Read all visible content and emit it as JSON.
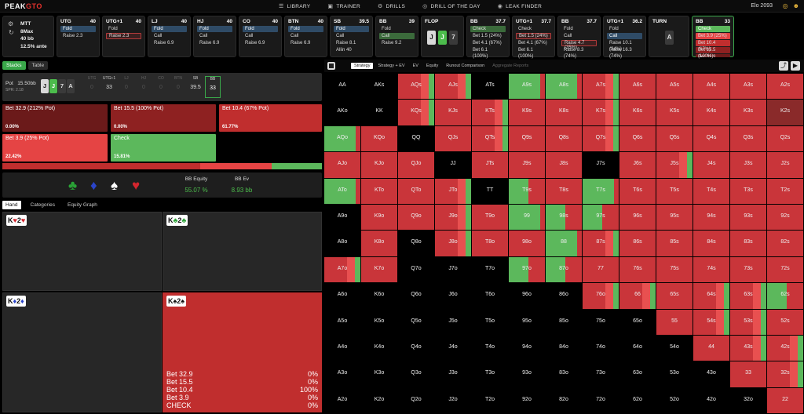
{
  "app": {
    "logo_main": "PEAK",
    "logo_accent": "GTO"
  },
  "nav": [
    {
      "icon": "☰",
      "label": "LIBRARY"
    },
    {
      "icon": "▣",
      "label": "TRAINER"
    },
    {
      "icon": "⚙",
      "label": "DRILLS"
    },
    {
      "icon": "◎",
      "label": "DRILL OF THE DAY"
    },
    {
      "icon": "◉",
      "label": "LEAK FINDER"
    }
  ],
  "elo": "Elo 2093",
  "settings": {
    "game": "MTT",
    "table": "8Max",
    "stack": "40 bb",
    "ante": "12.5% ante"
  },
  "positions": [
    {
      "name": "UTG",
      "stack": "40",
      "actions": [
        "Fold",
        "Raise 2.3"
      ],
      "sel": 0,
      "selstyle": "fold"
    },
    {
      "name": "UTG+1",
      "stack": "40",
      "actions": [
        "Fold",
        "Raise 2.3"
      ],
      "sel": 1,
      "selstyle": "red"
    },
    {
      "name": "LJ",
      "stack": "40",
      "actions": [
        "Fold",
        "Call",
        "Raise 6.9"
      ],
      "sel": 0,
      "selstyle": "fold"
    },
    {
      "name": "HJ",
      "stack": "40",
      "actions": [
        "Fold",
        "Call",
        "Raise 6.9"
      ],
      "sel": 0,
      "selstyle": "fold"
    },
    {
      "name": "CO",
      "stack": "40",
      "actions": [
        "Fold",
        "Call",
        "Raise 6.9"
      ],
      "sel": 0,
      "selstyle": "fold"
    },
    {
      "name": "BTN",
      "stack": "40",
      "actions": [
        "Fold",
        "Call",
        "Raise 6.9"
      ],
      "sel": 0,
      "selstyle": "fold"
    },
    {
      "name": "SB",
      "stack": "39.5",
      "actions": [
        "Fold",
        "Call",
        "Raise 8.1",
        "Allin 40"
      ],
      "sel": 0,
      "selstyle": "fold"
    },
    {
      "name": "BB",
      "stack": "39",
      "actions": [
        "Fold",
        "Call",
        "Raise 9.2"
      ],
      "sel": 1,
      "selstyle": "green"
    }
  ],
  "flop": {
    "name": "FLOP",
    "cards": [
      "J",
      "J",
      "7"
    ]
  },
  "postflop": [
    {
      "name": "BB",
      "stack": "37.7",
      "actions": [
        "Check",
        "Bet 1.5 (24%)",
        "Bet 4.1 (67%)",
        "Bet 6.1 (100%)"
      ],
      "sel": 0,
      "selstyle": "green"
    },
    {
      "name": "UTG+1",
      "stack": "37.7",
      "actions": [
        "Check",
        "Bet 1.5 (24%)",
        "Bet 4.1 (67%)",
        "Bet 6.1 (100%)"
      ],
      "sel": 1,
      "selstyle": "red"
    },
    {
      "name": "BB",
      "stack": "37.7",
      "actions": [
        "Fold",
        "Call",
        "Raise 4.7 (35%)",
        "Raise 8.3 (74%)"
      ],
      "sel": 2,
      "selstyle": "red"
    },
    {
      "name": "UTG+1",
      "stack": "36.2",
      "actions": [
        "Fold",
        "Call",
        "Raise 10.1 (34%)",
        "Raise 16.3 (74%)"
      ],
      "sel": 1,
      "selstyle": "fold"
    }
  ],
  "turn": {
    "name": "TURN",
    "card": "A"
  },
  "current": {
    "name": "BB",
    "stack": "33",
    "actions": [
      "Check",
      "Bet 3.9 (25%)",
      "Bet 10.4 (67%)",
      "Bet 15.5 (100%)",
      "Bet 32.9 (212%)"
    ]
  },
  "left_tabs": [
    "Stacks",
    "Table"
  ],
  "pot": {
    "label": "Pot",
    "value": "15.50bb",
    "spr": "SPR: 2.18",
    "cards": [
      "J",
      "J",
      "7",
      "A"
    ]
  },
  "pot_positions": [
    {
      "name": "UTG",
      "val": "0"
    },
    {
      "name": "UTG+1",
      "val": "33"
    },
    {
      "name": "LJ",
      "val": "0"
    },
    {
      "name": "HJ",
      "val": "0"
    },
    {
      "name": "CO",
      "val": "0"
    },
    {
      "name": "BTN",
      "val": "0"
    },
    {
      "name": "SB",
      "val": "39.5"
    },
    {
      "name": "BB",
      "val": "33"
    }
  ],
  "strategy": [
    {
      "label": "Bet 32.9 (212% Pot)",
      "pct": "0.00%",
      "color": "#6b1a1a"
    },
    {
      "label": "Bet 15.5 (100% Pot)",
      "pct": "0.00%",
      "color": "#8e2121"
    },
    {
      "label": "Bet 10.4 (67% Pot)",
      "pct": "61.77%",
      "color": "#c02e2e"
    },
    {
      "label": "Bet 3.9 (25% Pot)",
      "pct": "22.42%",
      "color": "#e54444"
    },
    {
      "label": "Check",
      "pct": "15.81%",
      "color": "#5cb85c"
    }
  ],
  "freqbar": [
    {
      "frac": 0.618,
      "color": "#c02e2e"
    },
    {
      "frac": 0.224,
      "color": "#e54444"
    },
    {
      "frac": 0.158,
      "color": "#5cb85c"
    }
  ],
  "equity": {
    "eq_label": "BB Equity",
    "eq_value": "55.07 %",
    "ev_label": "BB Ev",
    "ev_value": "8.93 bb"
  },
  "hand_tabs": [
    "Hand",
    "Categories",
    "Equity Graph"
  ],
  "hands": [
    {
      "rank1": "K",
      "suit1": "♥",
      "rank2": "2",
      "suit2": "♥",
      "color": "red"
    },
    {
      "rank1": "K",
      "suit1": "♣",
      "rank2": "2",
      "suit2": "♣",
      "color": "grn"
    },
    {
      "rank1": "K",
      "suit1": "♦",
      "rank2": "2",
      "suit2": "♦",
      "color": "blu"
    },
    {
      "rank1": "K",
      "suit1": "♠",
      "rank2": "2",
      "suit2": "♠",
      "color": "blk"
    }
  ],
  "hand_stats": [
    {
      "label": "Bet 32.9",
      "value": "0%"
    },
    {
      "label": "Bet 15.5",
      "value": "0%"
    },
    {
      "label": "Bet 10.4",
      "value": "100%"
    },
    {
      "label": "Bet 3.9",
      "value": "0%"
    },
    {
      "label": "CHECK",
      "value": "0%"
    }
  ],
  "grid_tabs": [
    "Strategy",
    "Strategy + EV",
    "EV",
    "Equity",
    "Runout Comparison",
    "Aggregate Reports"
  ],
  "ranks": [
    "A",
    "K",
    "Q",
    "J",
    "T",
    "9",
    "8",
    "7",
    "6",
    "5",
    "4",
    "3",
    "2"
  ],
  "grid": {
    "AA": "n",
    "AKs": "n",
    "AQs": "mr",
    "AJs": "mr",
    "ATs": "n",
    "A9s": "g",
    "A8s": "g",
    "A7s": "mr",
    "A6s": "r",
    "A5s": "r",
    "A4s": "r",
    "A3s": "r",
    "A2s": "r",
    "AKo": "n",
    "KK": "n",
    "KQs": "mr",
    "KJs": "r",
    "KTs": "mr",
    "K9s": "r",
    "K8s": "r",
    "K7s": "mr",
    "K6s": "r",
    "K5s": "r",
    "K4s": "r",
    "K3s": "r",
    "K2s": "d",
    "AQo": "g",
    "KQo": "r",
    "QQ": "n",
    "QJs": "r",
    "QTs": "mr",
    "Q9s": "r",
    "Q8s": "r",
    "Q7s": "mr",
    "Q6s": "r",
    "Q5s": "r",
    "Q4s": "r",
    "Q3s": "r",
    "Q2s": "r",
    "AJo": "r",
    "KJo": "r",
    "QJo": "r",
    "JJ": "n",
    "JTs": "r",
    "J9s": "r",
    "J8s": "r",
    "J7s": "n",
    "J6s": "r",
    "J5s": "mr",
    "J4s": "r",
    "J3s": "r",
    "J2s": "r",
    "ATo": "g",
    "KTo": "r",
    "QTo": "r",
    "JTo": "mr",
    "TT": "n",
    "T9s": "mg",
    "T8s": "r",
    "T7s": "g",
    "T6s": "r",
    "T5s": "r",
    "T4s": "r",
    "T3s": "r",
    "T2s": "r",
    "A9o": "n",
    "K9o": "r",
    "Q9o": "r",
    "J9o": "mr",
    "T9o": "r",
    "99": "g",
    "98s": "mg",
    "97s": "mg",
    "96s": "r",
    "95s": "r",
    "94s": "r",
    "93s": "r",
    "92s": "r",
    "A8o": "n",
    "K8o": "r",
    "Q8o": "n",
    "J8o": "mr",
    "T8o": "r",
    "98o": "r",
    "88": "g",
    "87s": "mr",
    "86s": "r",
    "85s": "r",
    "84s": "r",
    "83s": "r",
    "82s": "r",
    "A7o": "mr",
    "K7o": "r",
    "Q7o": "n",
    "J7o": "n",
    "T7o": "n",
    "97o": "mg",
    "87o": "mg",
    "77": "r",
    "76s": "r",
    "75s": "r",
    "74s": "r",
    "73s": "r",
    "72s": "r",
    "A6o": "n",
    "K6o": "n",
    "Q6o": "n",
    "J6o": "n",
    "T6o": "n",
    "96o": "n",
    "86o": "n",
    "76o": "mr",
    "66": "mr",
    "65s": "r",
    "64s": "mr",
    "63s": "mr",
    "62s": "mg",
    "A5o": "n",
    "K5o": "n",
    "Q5o": "n",
    "J5o": "n",
    "T5o": "n",
    "95o": "n",
    "85o": "n",
    "75o": "n",
    "65o": "n",
    "55": "r",
    "54s": "mr",
    "53s": "mr",
    "52s": "r",
    "A4o": "n",
    "K4o": "n",
    "Q4o": "n",
    "J4o": "n",
    "T4o": "n",
    "94o": "n",
    "84o": "n",
    "74o": "n",
    "64o": "n",
    "54o": "n",
    "44": "r",
    "43s": "mr",
    "42s": "mr",
    "A3o": "n",
    "K3o": "n",
    "Q3o": "n",
    "J3o": "n",
    "T3o": "n",
    "93o": "n",
    "83o": "n",
    "73o": "n",
    "63o": "n",
    "53o": "n",
    "43o": "n",
    "33": "r",
    "32s": "mr",
    "A2o": "n",
    "K2o": "n",
    "Q2o": "n",
    "J2o": "n",
    "T2o": "n",
    "92o": "n",
    "82o": "n",
    "72o": "n",
    "62o": "n",
    "52o": "n",
    "42o": "n",
    "32o": "n",
    "22": "r"
  },
  "colors": {
    "accent": "#3aa84a",
    "bet_dark": "#c02e2e",
    "bet_light": "#e54444",
    "check": "#5cb85c",
    "dark_red": "#7a2020"
  }
}
